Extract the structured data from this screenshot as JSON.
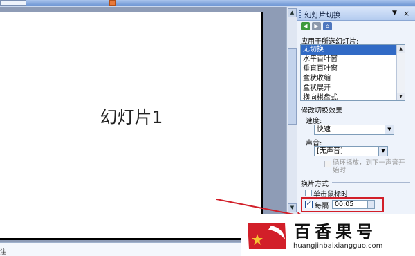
{
  "slide": {
    "title": "幻灯片1"
  },
  "notes": {
    "label": "注"
  },
  "task_pane": {
    "title": "幻灯片切换",
    "apply_label": "应用于所选幻灯片:",
    "transitions": [
      "无切换",
      "水平百叶窗",
      "垂直百叶窗",
      "盒状收缩",
      "盒状展开",
      "横向棋盘式"
    ],
    "selected_transition": "无切换",
    "modify_label": "修改切换效果",
    "speed_label": "速度:",
    "speed_value": "快速",
    "sound_label": "声音:",
    "sound_value": "[无声音]",
    "loop_label": "循环播放，到下一声音开始时",
    "advance_label": "换片方式",
    "on_click_label": "单击鼠标时",
    "on_click_checked": false,
    "every_label": "每隔",
    "every_checked": true,
    "every_value": "00:05"
  },
  "watermark": {
    "name": "百香果号",
    "url": "huangjinbaixiangguo.com"
  },
  "colors": {
    "highlight_box": "#d21f29",
    "selection": "#316ac5"
  }
}
